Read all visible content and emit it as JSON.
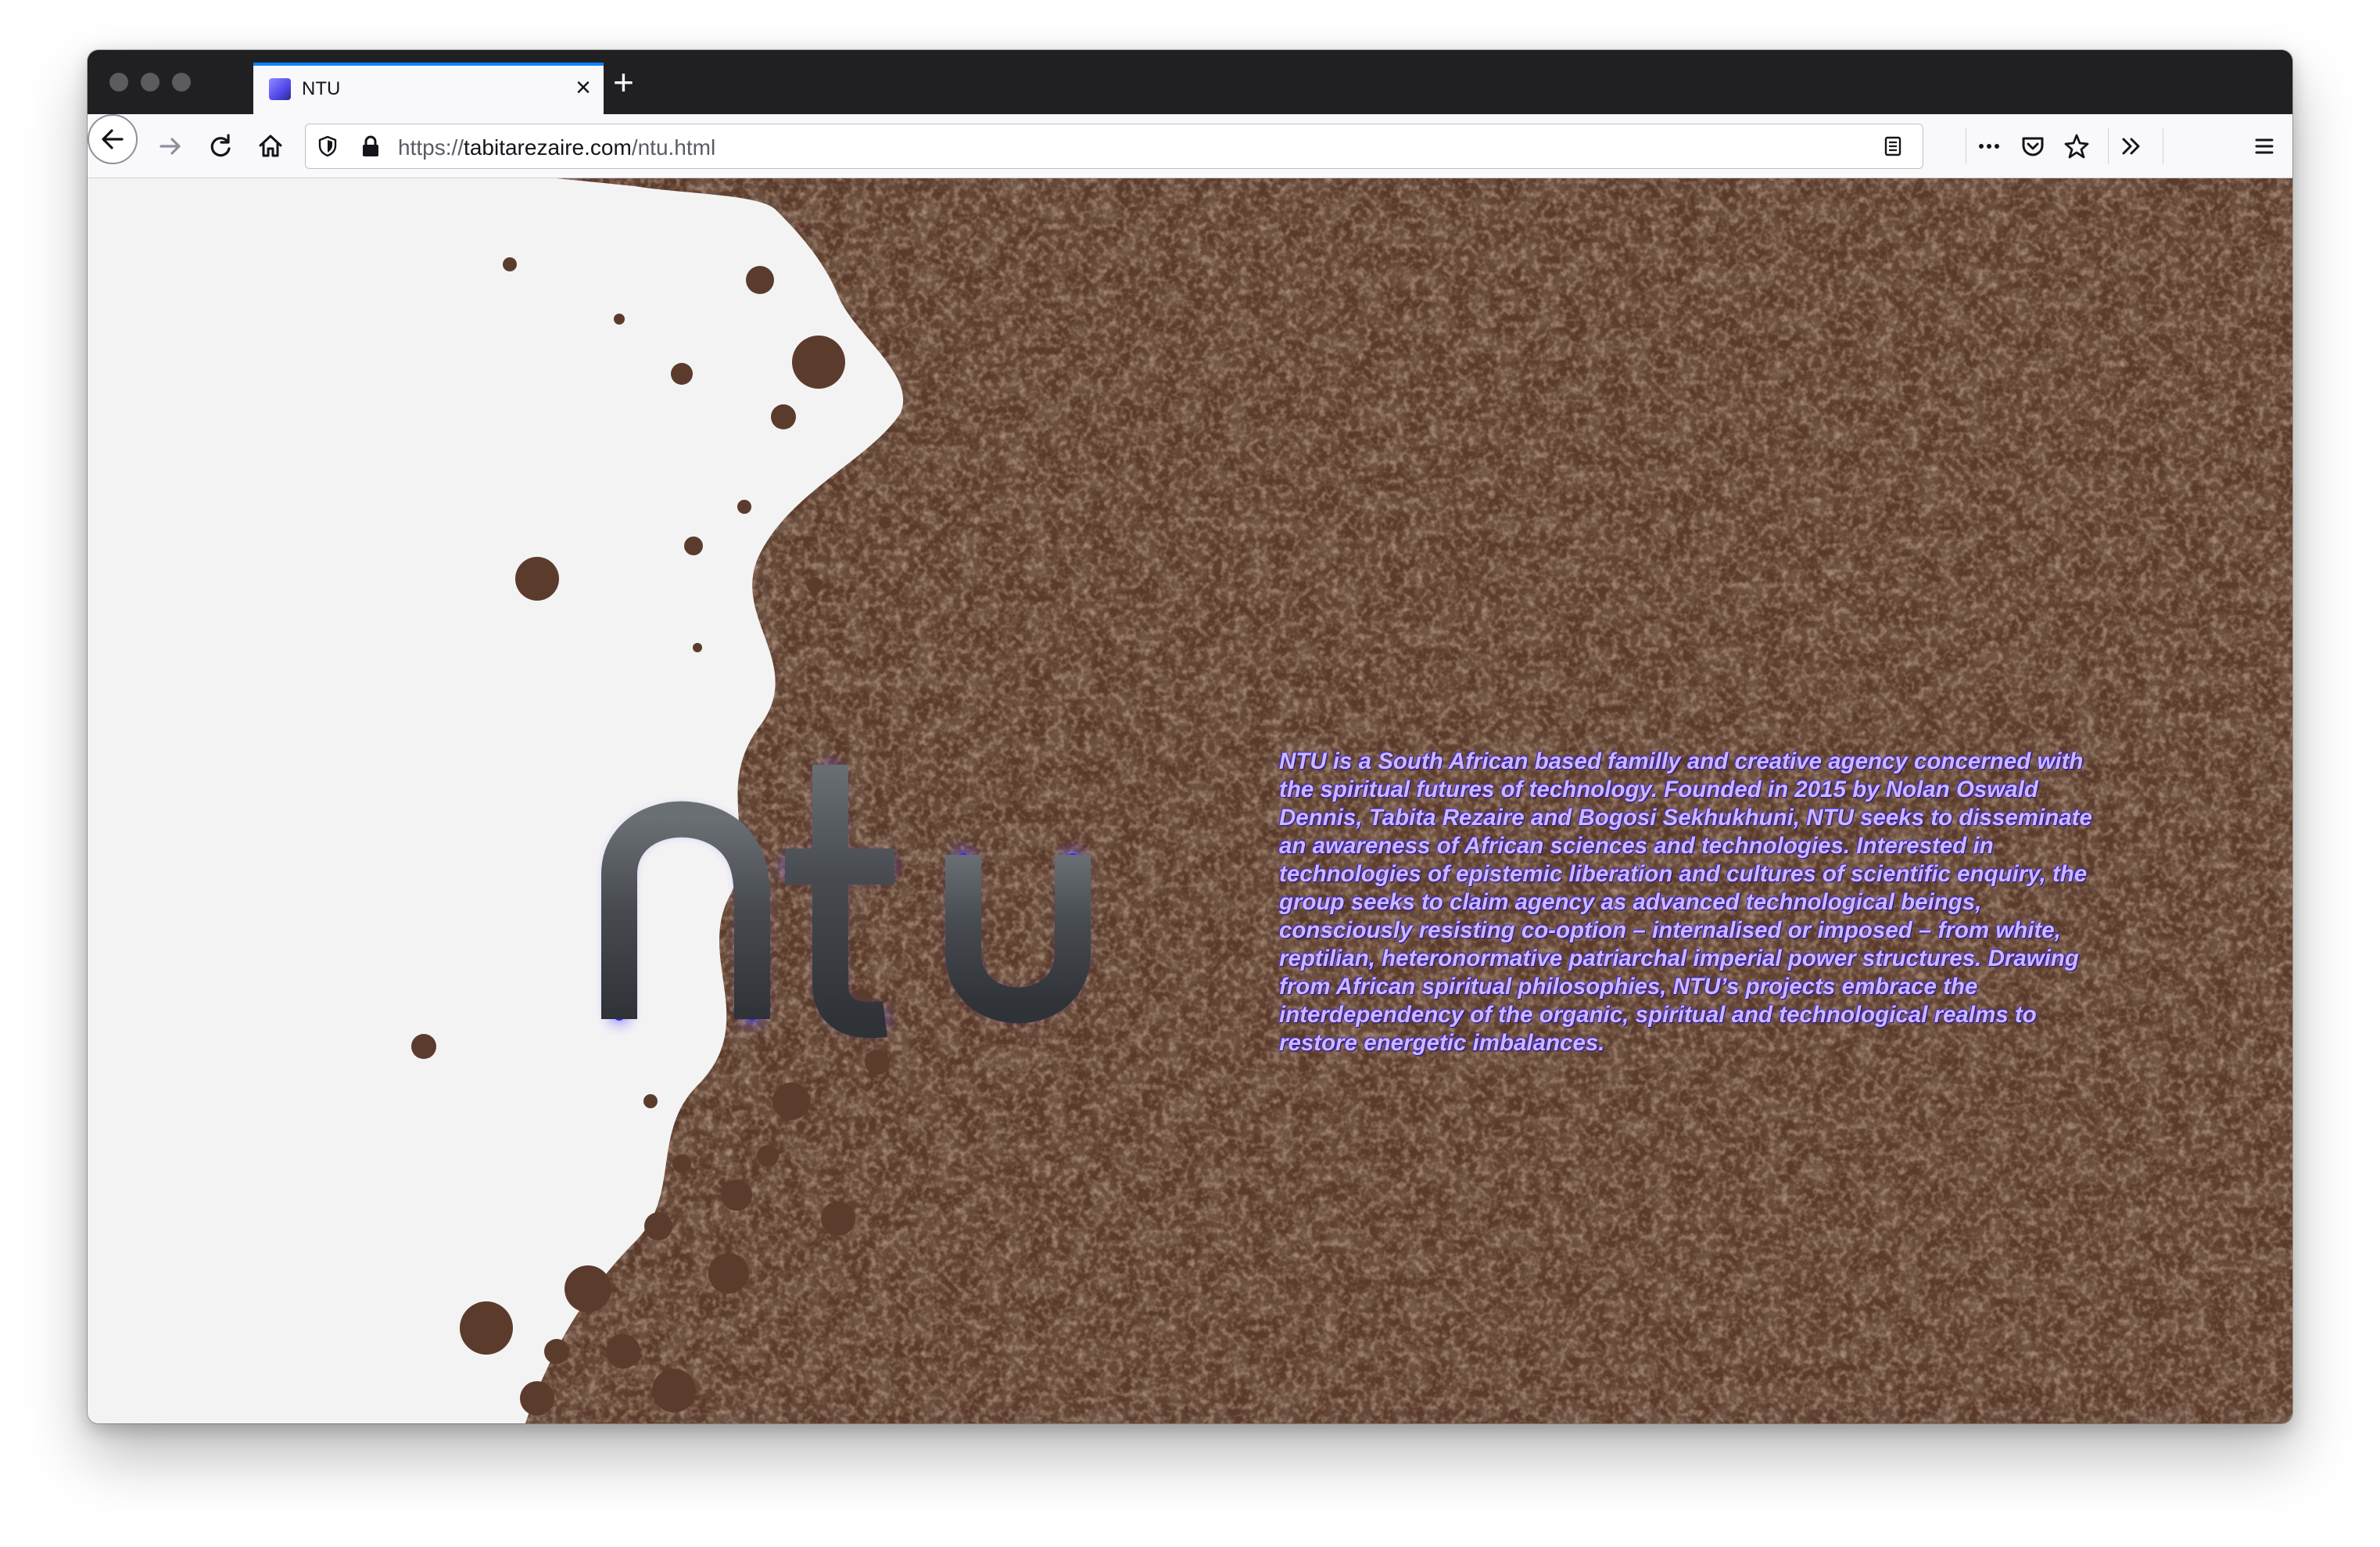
{
  "browser": {
    "tab_title": "NTU",
    "url_scheme": "https://",
    "url_host": "tabitarezaire.com",
    "url_path": "/ntu.html"
  },
  "page": {
    "logo_text": "ntu",
    "description": "NTU is a South African based familly and creative agency concerned with the spiritual futures of technology. Founded in 2015 by Nolan Oswald Dennis, Tabita Rezaire and Bogosi Sekhukhuni, NTU seeks to disseminate an awareness of African sciences and technologies. Interested in technologies of epistemic liberation and cultures of scientific enquiry, the group seeks to claim agency as advanced technological beings, consciously resisting co-option – internalised or imposed – from white, reptilian, heteronormative patriarchal imperial power structures. Drawing from African spiritual philosophies, NTU’s projects embrace the interdependency of the organic, spiritual and technological realms to restore energetic imbalances."
  },
  "colors": {
    "accent": "#0a84ff",
    "logo_glow": "#6e5cff",
    "logo_fill": "#4a4e52",
    "text": "#cbb9ff",
    "soil": "#5a3b2b"
  },
  "icons": [
    "back-arrow-icon",
    "forward-arrow-icon",
    "reload-icon",
    "home-icon",
    "shield-icon",
    "lock-icon",
    "reader-view-icon",
    "more-icon",
    "pocket-icon",
    "bookmark-star-icon",
    "overflow-chevron-icon",
    "hamburger-menu-icon",
    "close-icon",
    "plus-icon"
  ]
}
